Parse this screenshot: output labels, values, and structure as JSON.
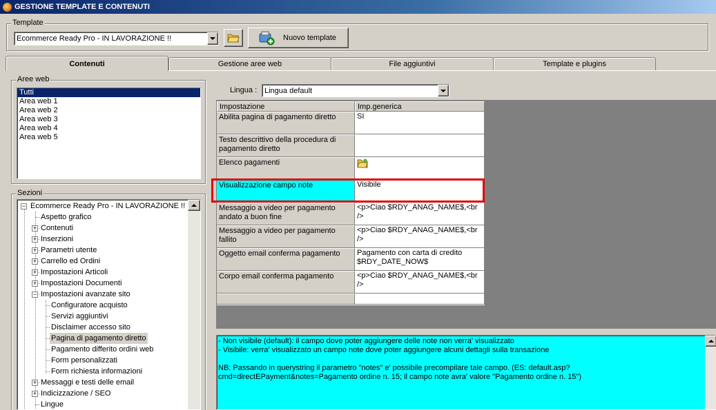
{
  "window": {
    "title": "GESTIONE TEMPLATE E CONTENUTI"
  },
  "template_group": {
    "label": "Template",
    "selected": "Ecommerce Ready Pro - IN LAVORAZIONE !!",
    "new_button_label": "Nuovo template"
  },
  "tabs": [
    {
      "label": "Contenuti",
      "active": true
    },
    {
      "label": "Gestione aree web",
      "active": false
    },
    {
      "label": "File aggiuntivi",
      "active": false
    },
    {
      "label": "Template e plugins",
      "active": false
    }
  ],
  "aree_web": {
    "label": "Aree web",
    "items": [
      "Tutti",
      "Area web 1",
      "Area web 2",
      "Area web 3",
      "Area web 4",
      "Area web 5"
    ],
    "selected_index": 0
  },
  "sezioni": {
    "label": "Sezioni",
    "root": "Ecommerce Ready Pro - IN LAVORAZIONE !!",
    "items": [
      {
        "label": "Aspetto grafico",
        "level": 1,
        "expandable": false
      },
      {
        "label": "Contenuti",
        "level": 1,
        "expandable": true
      },
      {
        "label": "Inserzioni",
        "level": 1,
        "expandable": true
      },
      {
        "label": "Parametri utente",
        "level": 1,
        "expandable": true
      },
      {
        "label": "Carrello ed Ordini",
        "level": 1,
        "expandable": true
      },
      {
        "label": "Impostazioni Articoli",
        "level": 1,
        "expandable": true
      },
      {
        "label": "Impostazioni Documenti",
        "level": 1,
        "expandable": true
      },
      {
        "label": "Impostazioni avanzate sito",
        "level": 1,
        "expanded": true
      },
      {
        "label": "Configuratore acquisto",
        "level": 2
      },
      {
        "label": "Servizi aggiuntivi",
        "level": 2
      },
      {
        "label": "Disclaimer accesso sito",
        "level": 2
      },
      {
        "label": "Pagina di pagamento diretto",
        "level": 2,
        "selected": true
      },
      {
        "label": "Pagamento differito ordini web",
        "level": 2
      },
      {
        "label": "Form personalizzati",
        "level": 2
      },
      {
        "label": "Form richiesta informazioni",
        "level": 2
      },
      {
        "label": "Messaggi e testi delle email",
        "level": 1,
        "expandable": true
      },
      {
        "label": "Indicizzazione / SEO",
        "level": 1,
        "expandable": true
      },
      {
        "label": "Lingue",
        "level": 1,
        "expandable": false
      }
    ]
  },
  "lingua": {
    "label": "Lingua :",
    "selected": "Lingua default"
  },
  "grid": {
    "headers": [
      "Impostazione",
      "Imp.generica"
    ],
    "rows": [
      {
        "key": "Abilita pagina di pagamento diretto",
        "value": "SI"
      },
      {
        "key": "Testo descrittivo della procedura di pagamento diretto",
        "value": ""
      },
      {
        "key": "Elenco pagamenti",
        "value": "",
        "icon": "folder-icon"
      },
      {
        "key": "Visualizzazione campo note",
        "value": "Visibile",
        "highlight": true
      },
      {
        "key": "Messaggio a video per pagamento andato a buon fine",
        "value": "<p>Ciao $RDY_ANAG_NAME$,<br />"
      },
      {
        "key": "Messaggio a video per pagamento fallito",
        "value": "<p>Ciao $RDY_ANAG_NAME$,<br />"
      },
      {
        "key": "Oggetto email conferma pagamento",
        "value": "Pagamento con carta di credito $RDY_DATE_NOW$"
      },
      {
        "key": "Corpo email conferma pagamento",
        "value": "<p>Ciao $RDY_ANAG_NAME$,<br />"
      },
      {
        "key": "",
        "value": ""
      }
    ]
  },
  "description": {
    "lines": [
      "- Non visibile (default): il campo dove poter aggiungere delle note non verra' visualizzato",
      "- Visibile: verra' visualizzato un campo note dove poter aggiungere alcuni dettagli sulla transazione",
      "",
      "NB: Passando in querystring il parametro \"notes\" e' possibile precompilare tale campo. (ES: default.asp?cmd=directEPayment&notes=Pagamento ordine n. 15; il campo note avra' valore \"Pagamento ordine n. 15\")"
    ]
  },
  "colors": {
    "highlight": "#00ffff",
    "selection": "#0a246a",
    "red_outline": "#e00000",
    "titlebar": "#0a246a"
  }
}
